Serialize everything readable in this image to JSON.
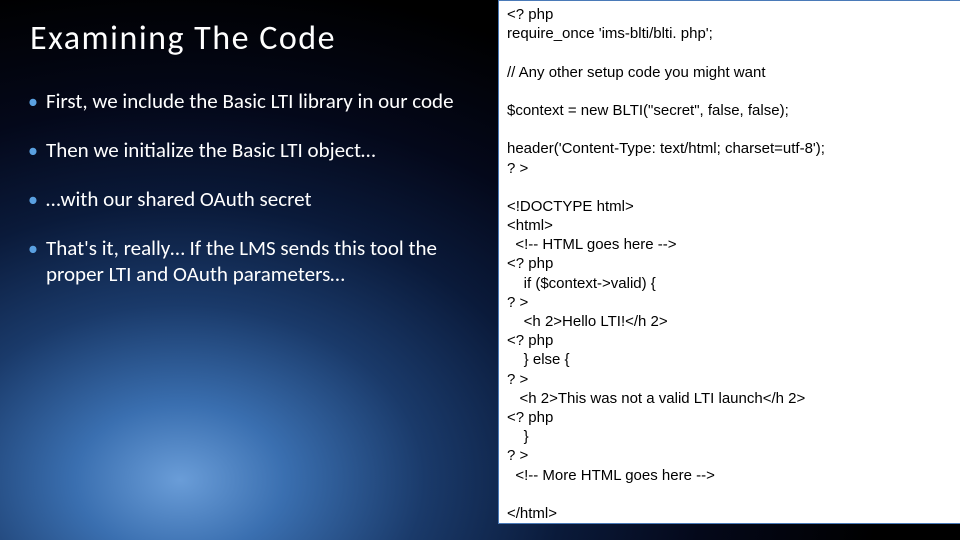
{
  "title": "Examining The Code",
  "bullets": [
    "First, we include the Basic LTI library in our code",
    "Then we initialize the Basic LTI object…",
    "…with our shared OAuth secret",
    "That's it, really… If the LMS sends this tool the proper LTI and OAuth parameters…"
  ],
  "code": "<? php\nrequire_once 'ims-blti/blti. php';\n\n// Any other setup code you might want\n\n$context = new BLTI(\"secret\", false, false);\n\nheader('Content-Type: text/html; charset=utf-8');\n? >\n\n<!DOCTYPE html>\n<html>\n  <!-- HTML goes here -->\n<? php\n    if ($context->valid) {\n? >\n    <h 2>Hello LTI!</h 2>\n<? php\n    } else {\n? >\n   <h 2>This was not a valid LTI launch</h 2>\n<? php\n    }\n? >\n  <!-- More HTML goes here -->\n\n</html>"
}
